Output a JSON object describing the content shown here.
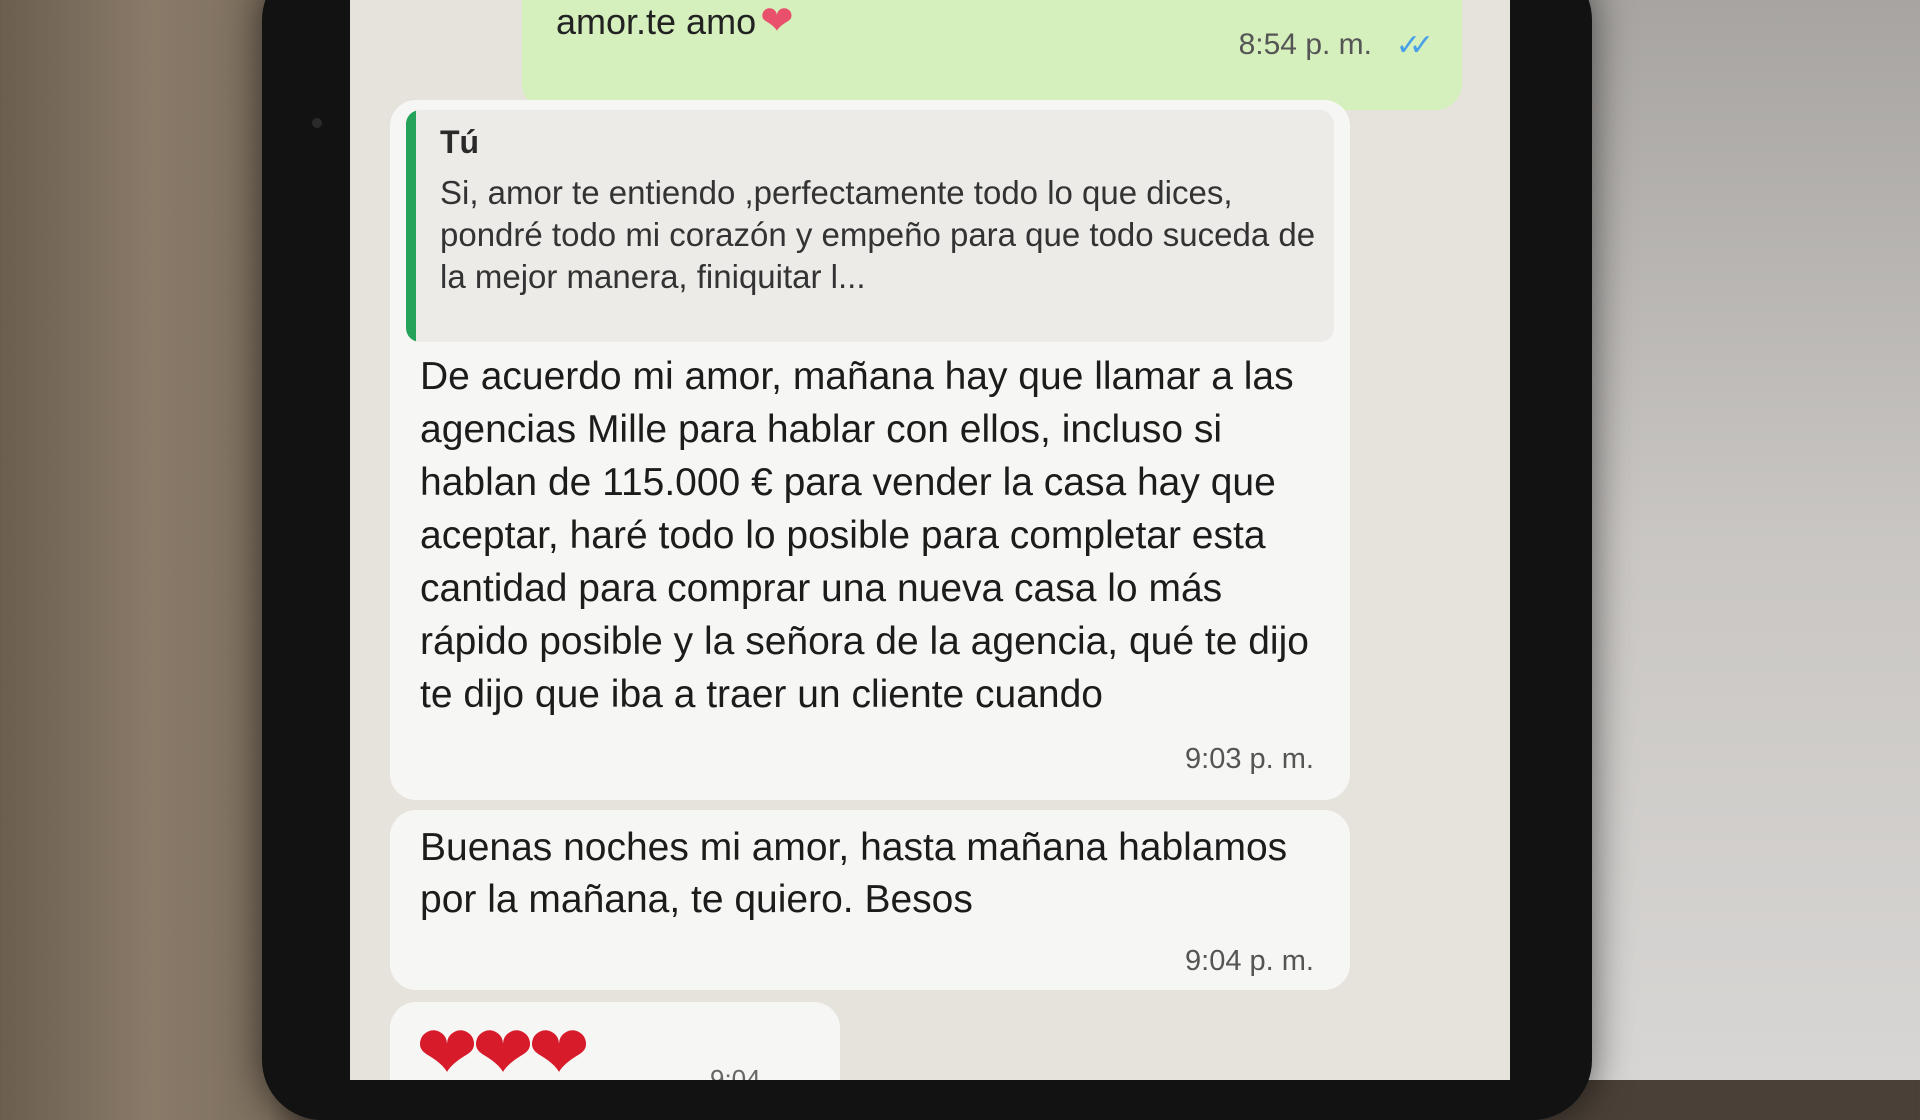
{
  "chat": {
    "outgoing": {
      "text": "amor.te amo",
      "heart_icon": "heart-icon",
      "time": "8:54 p. m.",
      "status_icon": "double-check-icon",
      "status_color": "#4aa0e8"
    },
    "incoming_reply": {
      "quote_author": "Tú",
      "quote_text": "Si, amor te entiendo ,perfectamente todo lo que dices, pondré todo mi corazón y empeño para que todo suceda de la mejor manera, finiquitar l...",
      "text": "De acuerdo mi amor, mañana hay que llamar a las agencias Mille para hablar con ellos, incluso si hablan de 115.000 € para vender la casa hay que aceptar, haré todo lo posible para completar esta cantidad para comprar una nueva casa lo más rápido posible y la señora de la agencia, qué te dijo te dijo que iba a traer un cliente cuando",
      "time": "9:03 p. m."
    },
    "incoming_2": {
      "text": "Buenas noches mi amor, hasta mañana hablamos por la mañana, te quiero. Besos",
      "time": "9:04 p. m."
    },
    "incoming_3": {
      "emoji": "❤❤❤",
      "time": "9:04"
    }
  },
  "colors": {
    "outgoing_bubble": "#d5f0bd",
    "incoming_bubble": "#f6f6f4",
    "quote_bar": "#25a35a",
    "chat_background": "#e6e2dc"
  }
}
